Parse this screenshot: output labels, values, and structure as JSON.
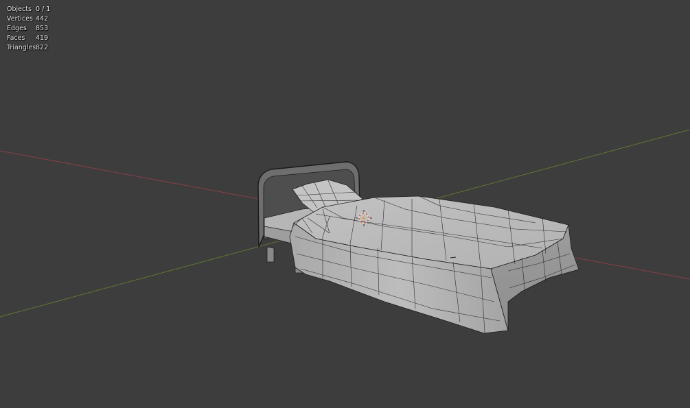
{
  "viewport": {
    "background": "#3d3d3d",
    "axis_x_color": "#8a3f48",
    "axis_y_color": "#5f7a2f"
  },
  "stats": [
    {
      "label": "Objects",
      "value": "0 / 1"
    },
    {
      "label": "Vertices",
      "value": "442"
    },
    {
      "label": "Edges",
      "value": "853"
    },
    {
      "label": "Faces",
      "value": "419"
    },
    {
      "label": "Triangles",
      "value": "822"
    }
  ],
  "model": {
    "name": "bed",
    "shading": "solid",
    "wireframe_overlay": true,
    "origin_icon": "3d-cursor-icon"
  }
}
